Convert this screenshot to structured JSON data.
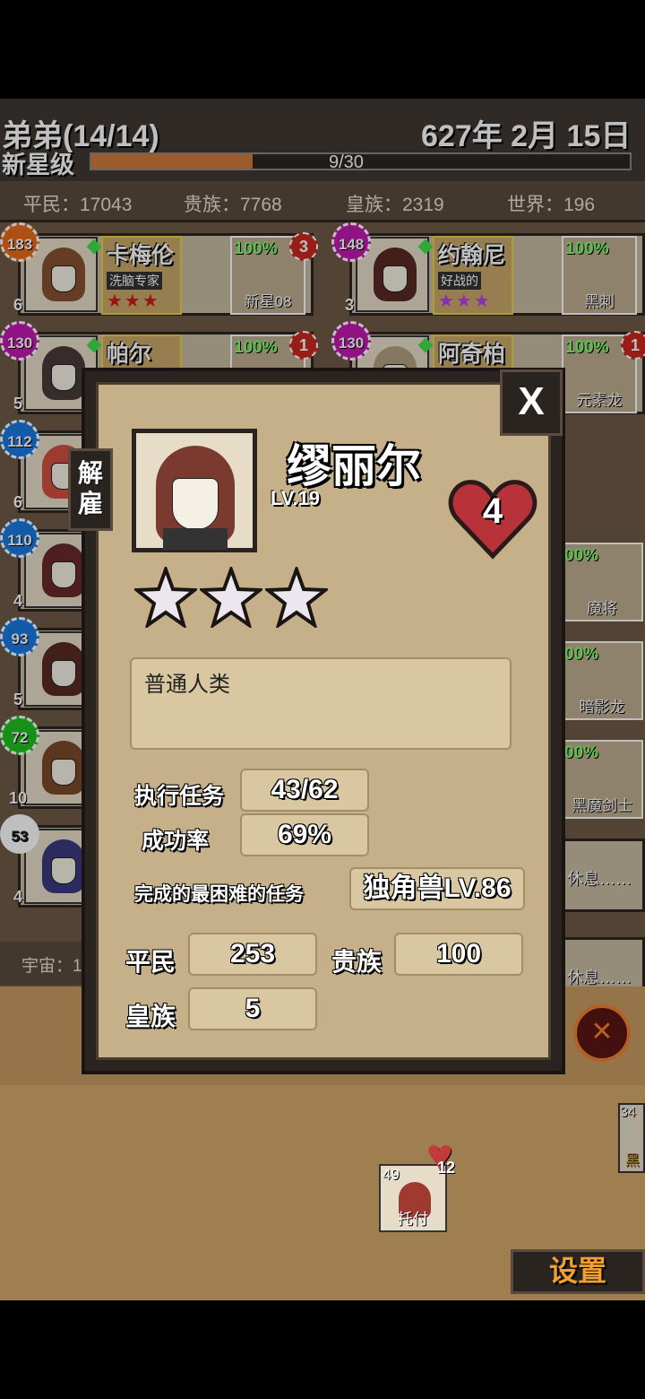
{
  "header": {
    "guild_name": "弟弟(14/14)",
    "date": "627年 2月 15日",
    "rank": "新星级",
    "rank_progress_text": "9/30",
    "rank_progress": 0.3
  },
  "stats": {
    "commoner": "平民：17043",
    "noble": "贵族：7768",
    "royal": "皇族：2319",
    "world": "世界：196",
    "universe": "宇宙：1"
  },
  "roster": [
    {
      "level": "183",
      "level_color": "#e86a1a",
      "hearts": "6",
      "name": "卡梅伦",
      "trait": "洗脑专家",
      "stars": "★★★",
      "star_color": "#d01a1a",
      "pct": "100%",
      "item": "新星08",
      "badge": "3",
      "hair": "#8a5030"
    },
    {
      "level": "148",
      "level_color": "#c01ab0",
      "hearts": "3",
      "name": "约翰尼",
      "trait": "好战的",
      "stars": "★★★",
      "star_color": "#b040f0",
      "pct": "100%",
      "item": "黑刺",
      "hair": "#5a2a26"
    },
    {
      "level": "130",
      "level_color": "#c01ab0",
      "hearts": "5",
      "name": "帕尔",
      "pct": "100%",
      "badge": "1",
      "hair": "#4a3a3a"
    },
    {
      "level": "130",
      "level_color": "#c01ab0",
      "name": "阿奇柏德",
      "pct": "100%",
      "item": "元素龙",
      "badge": "1",
      "hair": "#b0a080"
    },
    {
      "level": "112",
      "level_color": "#1a7ae0",
      "hearts": "6",
      "hair": "#d05040"
    },
    {
      "level": "110",
      "level_color": "#1a7ae0",
      "hearts": "4",
      "hair": "#6a2a2a"
    },
    {
      "level": "93",
      "level_color": "#1a7ae0",
      "hearts": "5",
      "hair": "#5a2a22"
    },
    {
      "level": "72",
      "level_color": "#20c020",
      "hearts": "10",
      "hair": "#7a4a2a"
    },
    {
      "level": "53",
      "level_color": "#ffffff",
      "hearts": "4",
      "hair": "#3a3a80"
    }
  ],
  "right_items": [
    {
      "pct": "00%",
      "item": "魔将"
    },
    {
      "pct": "00%",
      "item": "暗影龙"
    },
    {
      "pct": "00%",
      "item": "黑魔剑士"
    }
  ],
  "resting": [
    "休息……",
    "休息……"
  ],
  "modal": {
    "dismiss_label": "解雇",
    "close_label": "X",
    "name": "缪丽尔",
    "level": "LV.19",
    "loyalty": "4",
    "stars": 3,
    "description": "普通人类",
    "missions_label": "执行任务",
    "missions_value": "43/62",
    "success_label": "成功率",
    "success_value": "69%",
    "hardest_label": "完成的最困难的任务",
    "hardest_value": "独角兽LV.86",
    "commoner_label": "平民",
    "commoner_value": "253",
    "noble_label": "贵族",
    "noble_value": "100",
    "royal_label": "皇族",
    "royal_value": "5"
  },
  "task": {
    "level": "49",
    "hearts": "12",
    "label": "托付"
  },
  "side_card": {
    "level": "34",
    "label": "黑"
  },
  "settings_label": "设置"
}
